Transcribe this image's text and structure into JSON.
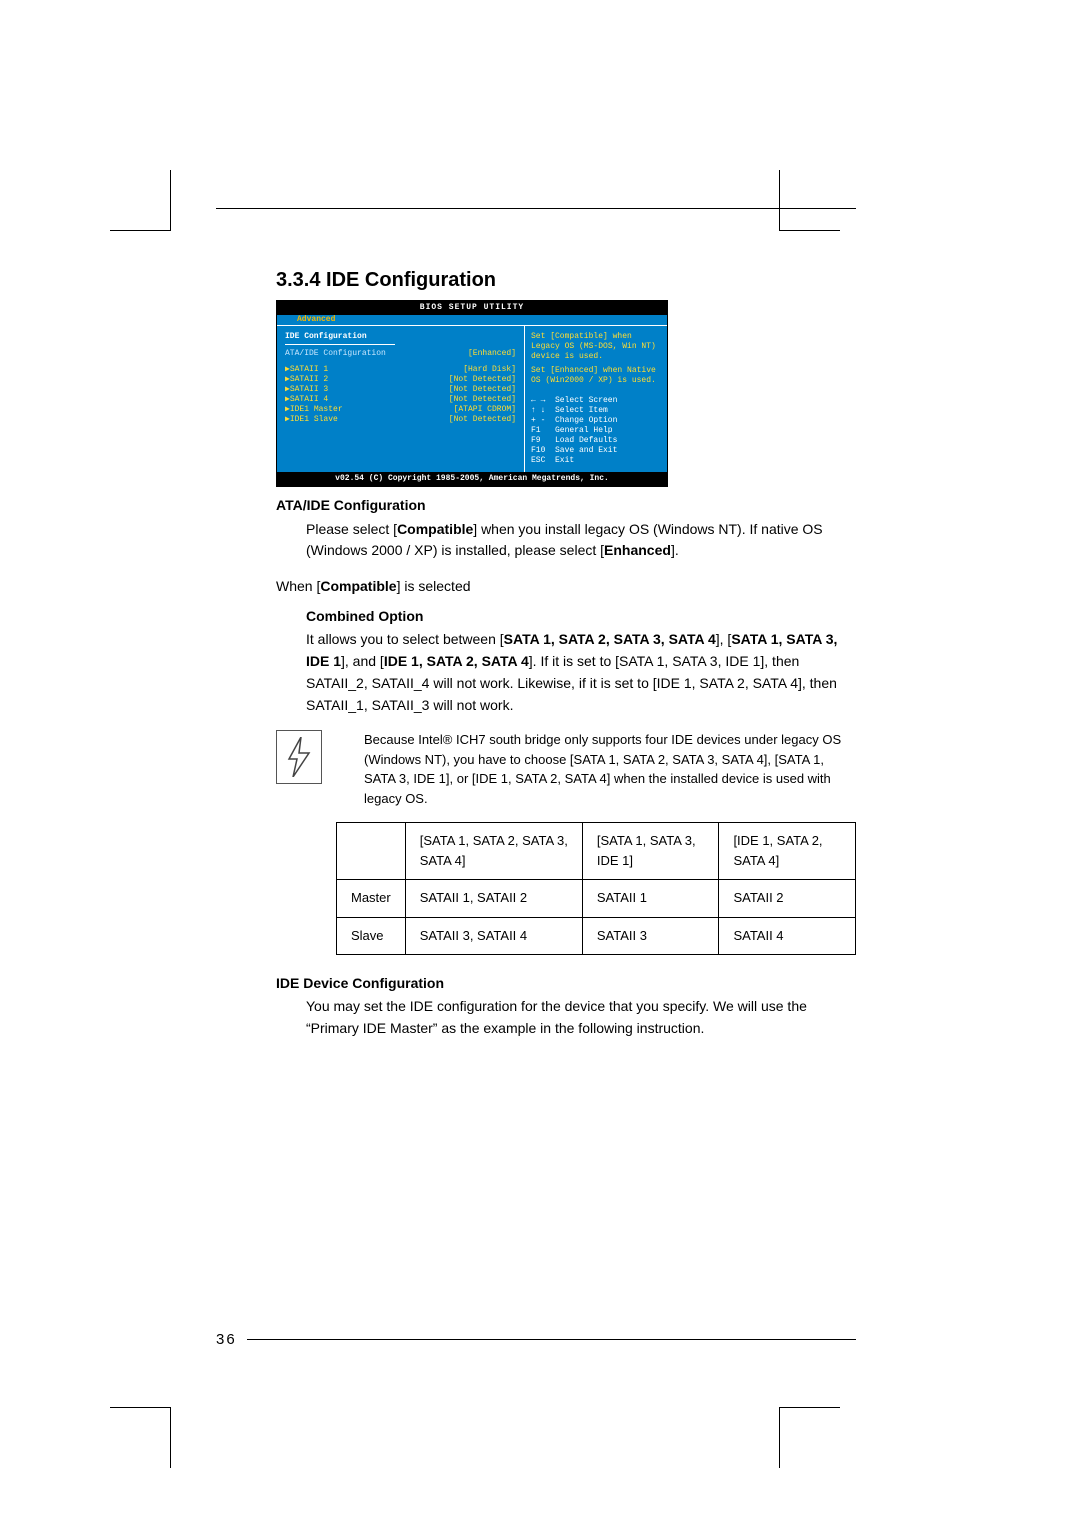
{
  "section_title": "3.3.4 IDE Configuration",
  "bios": {
    "title": "BIOS SETUP UTILITY",
    "tab": "Advanced",
    "heading": "IDE Configuration",
    "config_label": "ATA/IDE Configuration",
    "config_value": "[Enhanced]",
    "devices": [
      {
        "name": "SATAII 1",
        "value": "[Hard Disk]"
      },
      {
        "name": "SATAII 2",
        "value": "[Not Detected]"
      },
      {
        "name": "SATAII 3",
        "value": "[Not Detected]"
      },
      {
        "name": "SATAII 4",
        "value": "[Not Detected]"
      },
      {
        "name": "IDE1 Master",
        "value": "[ATAPI CDROM]"
      },
      {
        "name": "IDE1 Slave",
        "value": "[Not Detected]"
      }
    ],
    "help1": "Set [Compatible] when Legacy OS (MS-DOS, Win NT) device is used.",
    "help2": "Set [Enhanced] when Native OS (Win2000 / XP) is used.",
    "keys": [
      {
        "k": "← →",
        "d": "Select Screen"
      },
      {
        "k": "↑ ↓",
        "d": "Select Item"
      },
      {
        "k": "+ -",
        "d": "Change Option"
      },
      {
        "k": "F1",
        "d": "General Help"
      },
      {
        "k": "F9",
        "d": "Load Defaults"
      },
      {
        "k": "F10",
        "d": "Save and Exit"
      },
      {
        "k": "ESC",
        "d": "Exit"
      }
    ],
    "footer": "v02.54 (C) Copyright 1985-2005, American Megatrends, Inc."
  },
  "ata_heading": "ATA/IDE Configuration",
  "ata_para_pre": "Please select [",
  "ata_bold1": "Compatible",
  "ata_para_mid": "] when you install legacy OS (Windows NT). If native OS (Windows 2000 / XP) is installed, please select [",
  "ata_bold2": "Enhanced",
  "ata_para_post": "].",
  "when_compat_pre": "When [",
  "when_compat_bold": "Compatible",
  "when_compat_post": "] is selected",
  "combined_heading": "Combined Option",
  "combined_pre": "It allows you to select between [",
  "combined_b1": "SATA 1, SATA 2, SATA 3, SATA 4",
  "combined_mid1": "], [",
  "combined_b2": "SATA 1, SATA 3, IDE 1",
  "combined_mid2": "], and [",
  "combined_b3": "IDE 1, SATA 2, SATA 4",
  "combined_post": "]. If it is set to [SATA 1, SATA 3, IDE 1], then SATAII_2, SATAII_4 will not work. Likewise, if it is set to [IDE 1, SATA 2, SATA 4], then SATAII_1, SATAII_3 will not work.",
  "note_text": "Because Intel® ICH7 south bridge only supports four IDE devices under legacy OS (Windows NT), you have to choose [SATA 1, SATA 2, SATA 3, SATA 4], [SATA 1, SATA 3, IDE 1], or [IDE 1, SATA 2, SATA 4] when the installed device is used with legacy OS.",
  "table": {
    "headers": [
      "",
      "[SATA 1, SATA 2, SATA 3, SATA 4]",
      "[SATA 1, SATA 3, IDE 1]",
      "[IDE 1, SATA 2, SATA 4]"
    ],
    "rows": [
      [
        "Master",
        "SATAII 1, SATAII 2",
        "SATAII 1",
        "SATAII 2"
      ],
      [
        "Slave",
        "SATAII 3, SATAII 4",
        "SATAII 3",
        "SATAII 4"
      ]
    ]
  },
  "ide_dev_heading": "IDE Device Configuration",
  "ide_dev_para": "You may set the IDE configuration for the device that you specify. We will use the “Primary IDE Master” as the example in the following instruction.",
  "page_number": "36"
}
